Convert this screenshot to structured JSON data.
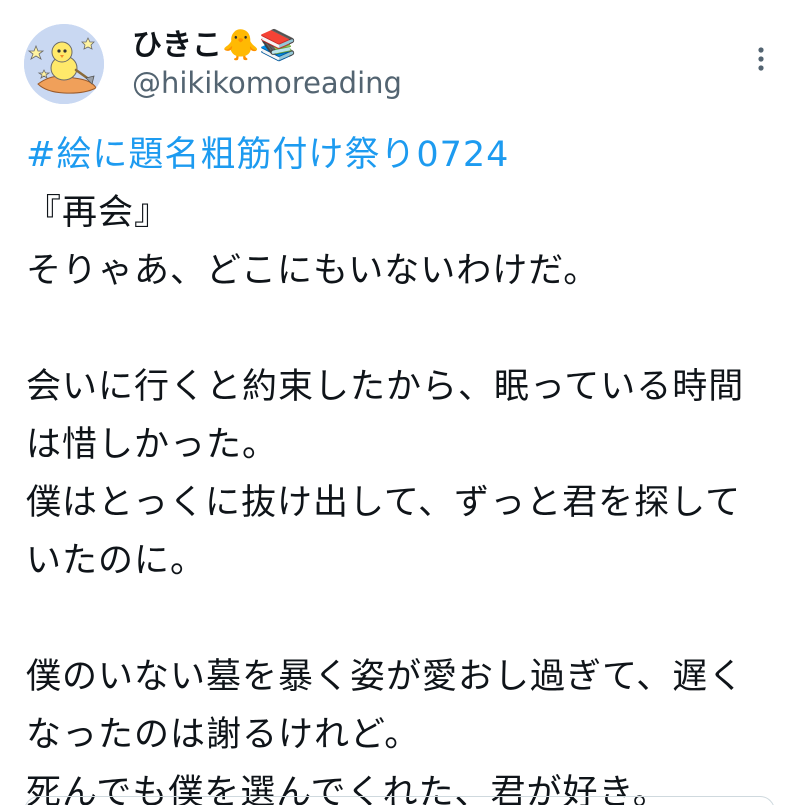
{
  "author": {
    "display_name": "ひきこ",
    "name_emojis": "🐥📚",
    "handle": "@hikikomoreading",
    "avatar_icon": "duck-character-avatar"
  },
  "menu": {
    "more_icon": "more-horizontal-icon"
  },
  "tweet": {
    "hashtag": "#絵に題名粗筋付け祭り0724",
    "lines": [
      "『再会』",
      "そりゃあ、どこにもいないわけだ。",
      "",
      "会いに行くと約束したから、眠っている時間",
      "は惜しかった。",
      "僕はとっくに抜け出して、ずっと君を探して",
      "いたのに。",
      "",
      "僕のいない墓を暴く姿が愛おし過ぎて、遅く",
      "なったのは謝るけれど。",
      "死んでも僕を選んでくれた、君が好き。"
    ]
  },
  "colors": {
    "link": "#1d9bf0",
    "text": "#0f1419",
    "secondary": "#536471",
    "avatar_bg": "#c9d8f2"
  }
}
